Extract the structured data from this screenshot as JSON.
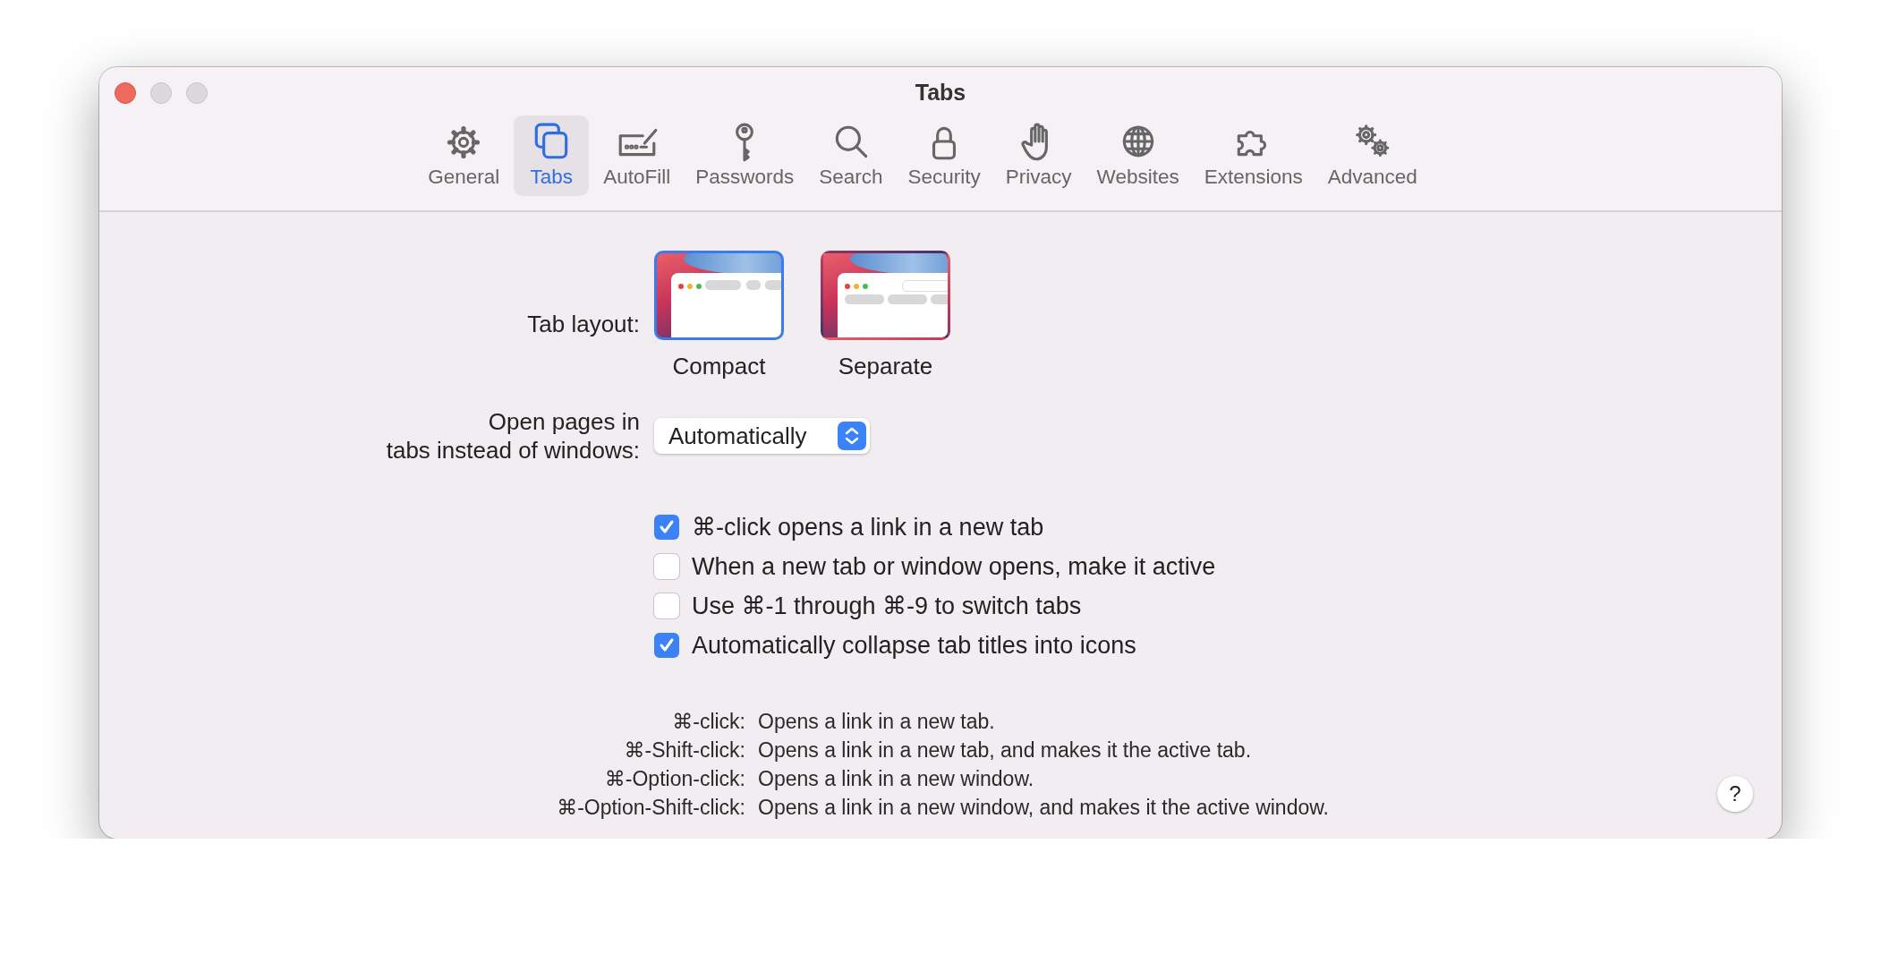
{
  "window": {
    "title": "Tabs"
  },
  "toolbar": [
    {
      "label": "General",
      "selected": false
    },
    {
      "label": "Tabs",
      "selected": true
    },
    {
      "label": "AutoFill",
      "selected": false
    },
    {
      "label": "Passwords",
      "selected": false
    },
    {
      "label": "Search",
      "selected": false
    },
    {
      "label": "Security",
      "selected": false
    },
    {
      "label": "Privacy",
      "selected": false
    },
    {
      "label": "Websites",
      "selected": false
    },
    {
      "label": "Extensions",
      "selected": false
    },
    {
      "label": "Advanced",
      "selected": false
    }
  ],
  "tab_layout": {
    "label": "Tab layout:",
    "options": [
      {
        "label": "Compact",
        "kind": "compact",
        "selected": true
      },
      {
        "label": "Separate",
        "kind": "separate",
        "selected": false
      }
    ]
  },
  "open_pages": {
    "label_lines": [
      "Open pages in",
      "tabs instead of windows:"
    ],
    "value": "Automatically"
  },
  "checkboxes": [
    {
      "label": "⌘-click opens a link in a new tab",
      "checked": true
    },
    {
      "label": "When a new tab or window opens, make it active",
      "checked": false
    },
    {
      "label": "Use ⌘-1 through ⌘-9 to switch tabs",
      "checked": false
    },
    {
      "label": "Automatically collapse tab titles into icons",
      "checked": true
    }
  ],
  "legend": [
    {
      "key": "⌘-click:",
      "text": "Opens a link in a new tab."
    },
    {
      "key": "⌘-Shift-click:",
      "text": "Opens a link in a new tab, and makes it the active tab."
    },
    {
      "key": "⌘-Option-click:",
      "text": "Opens a link in a new window."
    },
    {
      "key": "⌘-Option-Shift-click:",
      "text": "Opens a link in a new window, and makes it the active window."
    }
  ],
  "help": "?"
}
